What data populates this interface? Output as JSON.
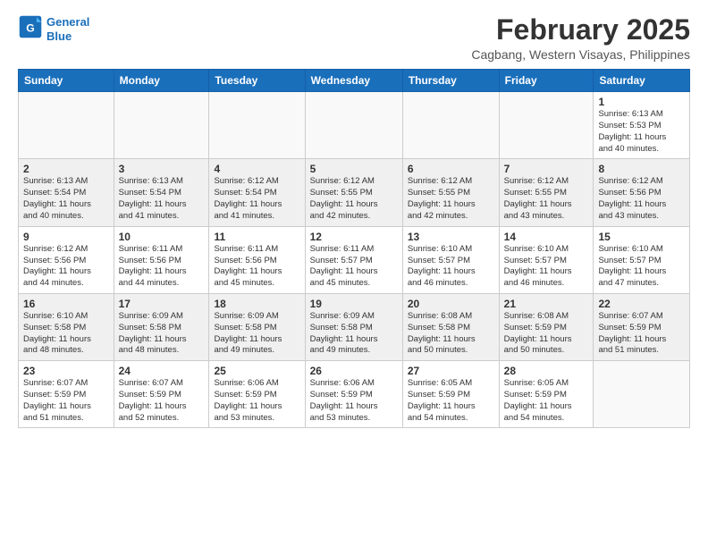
{
  "header": {
    "logo_line1": "General",
    "logo_line2": "Blue",
    "month": "February 2025",
    "location": "Cagbang, Western Visayas, Philippines"
  },
  "weekdays": [
    "Sunday",
    "Monday",
    "Tuesday",
    "Wednesday",
    "Thursday",
    "Friday",
    "Saturday"
  ],
  "weeks": [
    [
      {
        "day": "",
        "info": ""
      },
      {
        "day": "",
        "info": ""
      },
      {
        "day": "",
        "info": ""
      },
      {
        "day": "",
        "info": ""
      },
      {
        "day": "",
        "info": ""
      },
      {
        "day": "",
        "info": ""
      },
      {
        "day": "1",
        "info": "Sunrise: 6:13 AM\nSunset: 5:53 PM\nDaylight: 11 hours\nand 40 minutes."
      }
    ],
    [
      {
        "day": "2",
        "info": "Sunrise: 6:13 AM\nSunset: 5:54 PM\nDaylight: 11 hours\nand 40 minutes."
      },
      {
        "day": "3",
        "info": "Sunrise: 6:13 AM\nSunset: 5:54 PM\nDaylight: 11 hours\nand 41 minutes."
      },
      {
        "day": "4",
        "info": "Sunrise: 6:12 AM\nSunset: 5:54 PM\nDaylight: 11 hours\nand 41 minutes."
      },
      {
        "day": "5",
        "info": "Sunrise: 6:12 AM\nSunset: 5:55 PM\nDaylight: 11 hours\nand 42 minutes."
      },
      {
        "day": "6",
        "info": "Sunrise: 6:12 AM\nSunset: 5:55 PM\nDaylight: 11 hours\nand 42 minutes."
      },
      {
        "day": "7",
        "info": "Sunrise: 6:12 AM\nSunset: 5:55 PM\nDaylight: 11 hours\nand 43 minutes."
      },
      {
        "day": "8",
        "info": "Sunrise: 6:12 AM\nSunset: 5:56 PM\nDaylight: 11 hours\nand 43 minutes."
      }
    ],
    [
      {
        "day": "9",
        "info": "Sunrise: 6:12 AM\nSunset: 5:56 PM\nDaylight: 11 hours\nand 44 minutes."
      },
      {
        "day": "10",
        "info": "Sunrise: 6:11 AM\nSunset: 5:56 PM\nDaylight: 11 hours\nand 44 minutes."
      },
      {
        "day": "11",
        "info": "Sunrise: 6:11 AM\nSunset: 5:56 PM\nDaylight: 11 hours\nand 45 minutes."
      },
      {
        "day": "12",
        "info": "Sunrise: 6:11 AM\nSunset: 5:57 PM\nDaylight: 11 hours\nand 45 minutes."
      },
      {
        "day": "13",
        "info": "Sunrise: 6:10 AM\nSunset: 5:57 PM\nDaylight: 11 hours\nand 46 minutes."
      },
      {
        "day": "14",
        "info": "Sunrise: 6:10 AM\nSunset: 5:57 PM\nDaylight: 11 hours\nand 46 minutes."
      },
      {
        "day": "15",
        "info": "Sunrise: 6:10 AM\nSunset: 5:57 PM\nDaylight: 11 hours\nand 47 minutes."
      }
    ],
    [
      {
        "day": "16",
        "info": "Sunrise: 6:10 AM\nSunset: 5:58 PM\nDaylight: 11 hours\nand 48 minutes."
      },
      {
        "day": "17",
        "info": "Sunrise: 6:09 AM\nSunset: 5:58 PM\nDaylight: 11 hours\nand 48 minutes."
      },
      {
        "day": "18",
        "info": "Sunrise: 6:09 AM\nSunset: 5:58 PM\nDaylight: 11 hours\nand 49 minutes."
      },
      {
        "day": "19",
        "info": "Sunrise: 6:09 AM\nSunset: 5:58 PM\nDaylight: 11 hours\nand 49 minutes."
      },
      {
        "day": "20",
        "info": "Sunrise: 6:08 AM\nSunset: 5:58 PM\nDaylight: 11 hours\nand 50 minutes."
      },
      {
        "day": "21",
        "info": "Sunrise: 6:08 AM\nSunset: 5:59 PM\nDaylight: 11 hours\nand 50 minutes."
      },
      {
        "day": "22",
        "info": "Sunrise: 6:07 AM\nSunset: 5:59 PM\nDaylight: 11 hours\nand 51 minutes."
      }
    ],
    [
      {
        "day": "23",
        "info": "Sunrise: 6:07 AM\nSunset: 5:59 PM\nDaylight: 11 hours\nand 51 minutes."
      },
      {
        "day": "24",
        "info": "Sunrise: 6:07 AM\nSunset: 5:59 PM\nDaylight: 11 hours\nand 52 minutes."
      },
      {
        "day": "25",
        "info": "Sunrise: 6:06 AM\nSunset: 5:59 PM\nDaylight: 11 hours\nand 53 minutes."
      },
      {
        "day": "26",
        "info": "Sunrise: 6:06 AM\nSunset: 5:59 PM\nDaylight: 11 hours\nand 53 minutes."
      },
      {
        "day": "27",
        "info": "Sunrise: 6:05 AM\nSunset: 5:59 PM\nDaylight: 11 hours\nand 54 minutes."
      },
      {
        "day": "28",
        "info": "Sunrise: 6:05 AM\nSunset: 5:59 PM\nDaylight: 11 hours\nand 54 minutes."
      },
      {
        "day": "",
        "info": ""
      }
    ]
  ]
}
